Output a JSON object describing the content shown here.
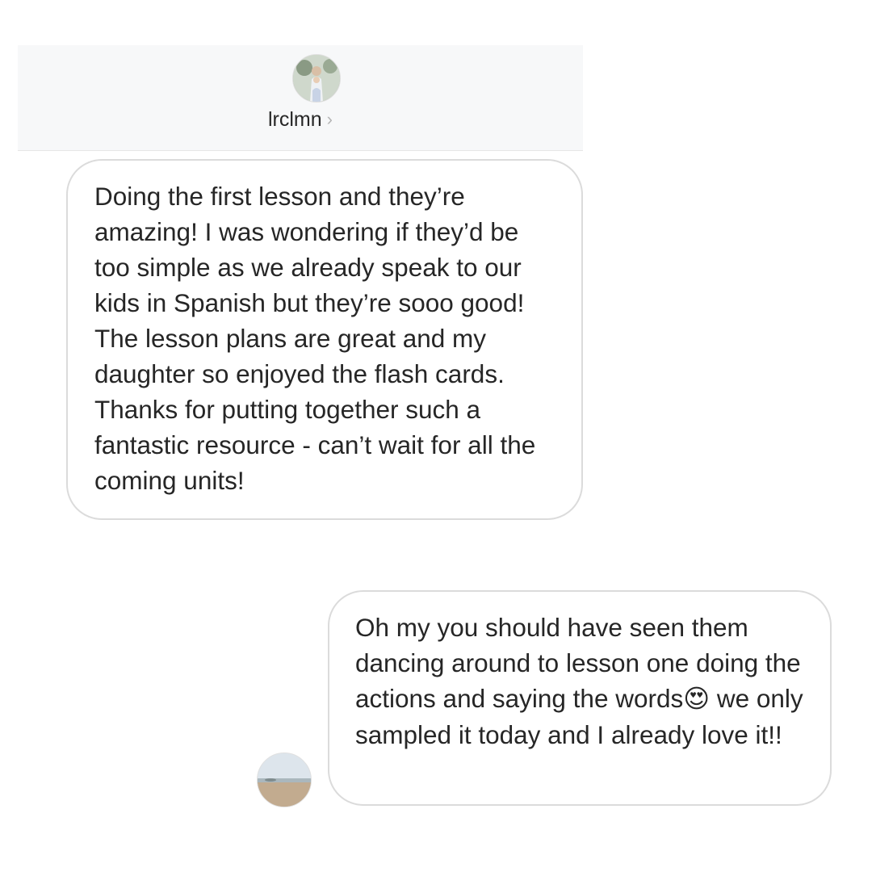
{
  "header": {
    "username": "lrclmn",
    "chevron": "›",
    "avatar_icon": "profile-photo-avatar"
  },
  "messages": [
    {
      "direction": "received",
      "text": "Doing the first lesson and they’re amazing! I was wondering if they’d be too simple as we already speak to our kids in Spanish but they’re sooo good! The lesson plans are great and my daughter so enjoyed the flash cards. Thanks for putting together such a fantastic resource - can’t wait for all the coming units!"
    },
    {
      "direction": "sent",
      "text": "Oh my you should have seen them dancing around to lesson one doing the actions and saying the words",
      "emoji": "😍",
      "text_after": "we only sampled it today and I already love it!!",
      "avatar_icon": "beach-photo-avatar"
    }
  ],
  "colors": {
    "header_bg": "#f7f8f9",
    "bubble_border": "#dbdbdb",
    "text": "#262626",
    "chevron": "#b5b5b5"
  }
}
